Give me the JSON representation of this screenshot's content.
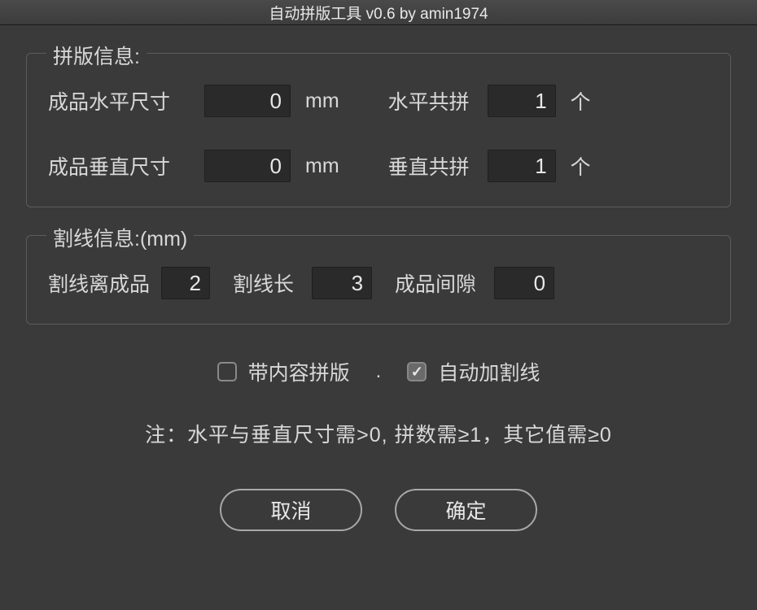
{
  "titlebar": "自动拼版工具 v0.6   by amin1974",
  "pinban": {
    "legend": "拼版信息:",
    "hsize_label": "成品水平尺寸",
    "hsize_value": "0",
    "hsize_unit": "mm",
    "hcount_label": "水平共拼",
    "hcount_value": "1",
    "hcount_unit": "个",
    "vsize_label": "成品垂直尺寸",
    "vsize_value": "0",
    "vsize_unit": "mm",
    "vcount_label": "垂直共拼",
    "vcount_value": "1",
    "vcount_unit": "个"
  },
  "gexian": {
    "legend": "割线信息:(mm)",
    "offset_label": "割线离成品",
    "offset_value": "2",
    "length_label": "割线长",
    "length_value": "3",
    "gap_label": "成品间隙",
    "gap_value": "0"
  },
  "options": {
    "with_content_label": "带内容拼版",
    "auto_cut_label": "自动加割线"
  },
  "note": "注：水平与垂直尺寸需>0, 拼数需≥1，其它值需≥0",
  "buttons": {
    "cancel": "取消",
    "ok": "确定"
  }
}
